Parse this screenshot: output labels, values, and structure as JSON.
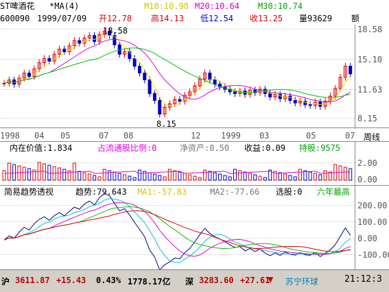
{
  "header": {
    "name": "ST啤酒花",
    "indicator": "*MA(4)",
    "ma10": "M10:10.98",
    "ma20": "M20:10.64",
    "ma30": "M30:10.74",
    "code": "600090",
    "date": "1999/07/09",
    "open": "开12.78",
    "high": "高14.13",
    "low": "低12.54",
    "close": "收13.25",
    "volume": "量93629",
    "amount": "额"
  },
  "price_axis": [
    "18.58",
    "15.10",
    "11.63",
    "8.15"
  ],
  "annot_high": "18.58",
  "annot_low": "8.15",
  "time_axis": [
    "1998",
    "04",
    "05",
    "07",
    "08",
    "12",
    "1999",
    "03",
    "05",
    "07"
  ],
  "period": "周线",
  "mid": {
    "iv": "内在价值:1.834",
    "ltg": "占流通股比例:0",
    "jzc": "净资产:0.50",
    "sy": "收益:0.09",
    "cg": "持股:9575",
    "axis": [
      "2.00",
      "0.00"
    ]
  },
  "low_panel": {
    "title": "简易趋势透视",
    "trend": "趋势:79.643",
    "ma1": "MA1:-57.83",
    "ma2": "MA2:-77.66",
    "xg": "选股:0",
    "liu": "六年最高",
    "axis": [
      "200.00",
      "100.00",
      "0.00",
      "-100.00"
    ]
  },
  "status": {
    "sh": "沪",
    "sh_val": "3611.87",
    "sh_chg": "+15.43",
    "sh_pct": "0.43%",
    "sh_amt": "1778.17亿",
    "sz": "深",
    "sz_val": "3283.60",
    "sz_chg": "+27.61",
    "ticker": "苏宁环球",
    "time": "21:12:3"
  },
  "colors": {
    "up": "#e00000",
    "down": "#000000",
    "ma_yellow": "#f0e000",
    "ma_magenta": "#e000e0",
    "ma_green": "#00c000",
    "blue": "#0000e0"
  }
}
